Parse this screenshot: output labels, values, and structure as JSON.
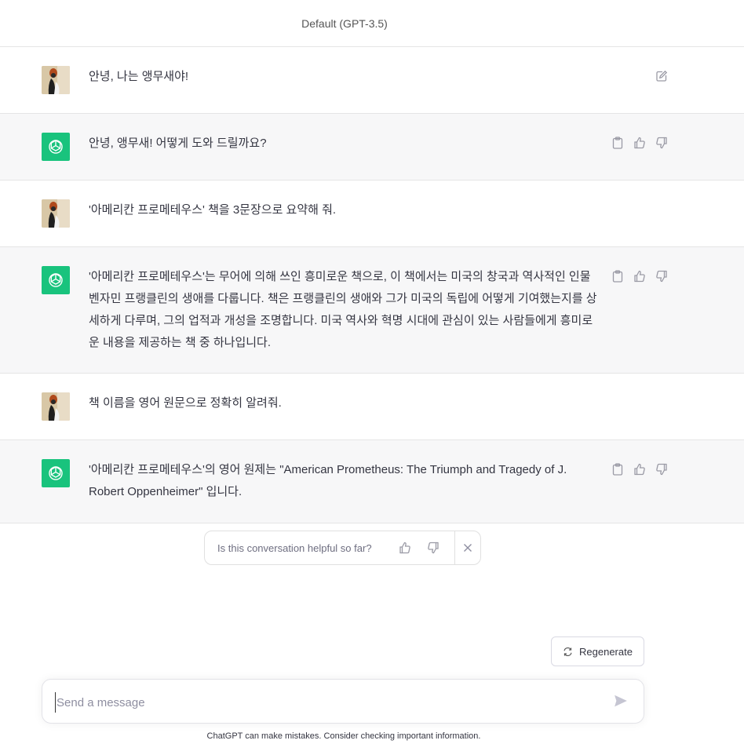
{
  "header": {
    "model_label": "Default (GPT-3.5)"
  },
  "messages": [
    {
      "role": "user",
      "text": "안녕, 나는 앵무새야!"
    },
    {
      "role": "assistant",
      "text": "안녕, 앵무새! 어떻게 도와 드릴까요?"
    },
    {
      "role": "user",
      "text": "'아메리칸 프로메테우스' 책을 3문장으로 요약해 줘."
    },
    {
      "role": "assistant",
      "text": "'아메리칸 프로메테우스'는 무어에 의해 쓰인 흥미로운 책으로, 이 책에서는 미국의 창국과 역사적인 인물 벤자민 프랭클린의 생애를 다룹니다. 책은 프랭클린의 생애와 그가 미국의 독립에 어떻게 기여했는지를 상세하게 다루며, 그의 업적과 개성을 조명합니다. 미국 역사와 혁명 시대에 관심이 있는 사람들에게 흥미로운 내용을 제공하는 책 중 하나입니다."
    },
    {
      "role": "user",
      "text": "책 이름을 영어 원문으로 정확히 알려줘."
    },
    {
      "role": "assistant",
      "text": "'아메리칸 프로메테우스'의 영어 원제는 \"American Prometheus: The Triumph and Tragedy of J. Robert Oppenheimer\" 입니다."
    }
  ],
  "feedback": {
    "prompt": "Is this conversation helpful so far?"
  },
  "regenerate": {
    "label": "Regenerate"
  },
  "composer": {
    "placeholder": "Send a message"
  },
  "footer": {
    "note": "ChatGPT can make mistakes. Consider checking important information."
  },
  "colors": {
    "assistant_avatar": "#19c37d",
    "assistant_row_bg": "#f7f7f8"
  },
  "icons": {
    "edit": "edit-icon",
    "copy": "clipboard-icon",
    "like": "thumbs-up-icon",
    "dislike": "thumbs-down-icon",
    "send": "send-icon",
    "regenerate": "refresh-icon",
    "close": "close-icon"
  }
}
